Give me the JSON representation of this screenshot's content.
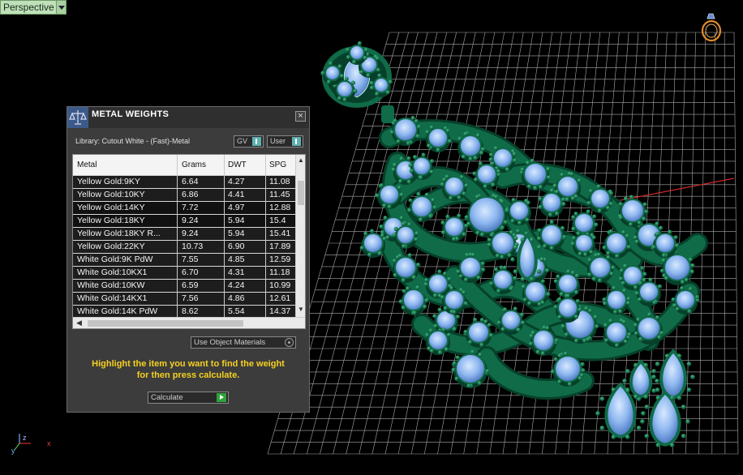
{
  "viewport": {
    "view_label": "Perspective",
    "axis_labels": {
      "y": "y",
      "z": "z",
      "x": "x"
    }
  },
  "panel": {
    "title": "METAL WEIGHTS",
    "library": "Library: Cutout White - (Fast)-Metal",
    "toggle_gv": "GV",
    "toggle_user": "User",
    "columns": [
      "Metal",
      "Grams",
      "DWT",
      "SPG"
    ],
    "rows": [
      [
        "Yellow Gold:9KY",
        "6.64",
        "4.27",
        "11.08"
      ],
      [
        "Yellow Gold:10KY",
        "6.86",
        "4.41",
        "11.45"
      ],
      [
        "Yellow Gold:14KY",
        "7.72",
        "4.97",
        "12.88"
      ],
      [
        "Yellow Gold:18KY",
        "9.24",
        "5.94",
        "15.4"
      ],
      [
        "Yellow Gold:18KY R...",
        "9.24",
        "5.94",
        "15.41"
      ],
      [
        "Yellow Gold:22KY",
        "10.73",
        "6.90",
        "17.89"
      ],
      [
        "White Gold:9K PdW",
        "7.55",
        "4.85",
        "12.59"
      ],
      [
        "White Gold:10KX1",
        "6.70",
        "4.31",
        "11.18"
      ],
      [
        "White Gold:10KW",
        "6.59",
        "4.24",
        "10.99"
      ],
      [
        "White Gold:14KX1",
        "7.56",
        "4.86",
        "12.61"
      ],
      [
        "White Gold:14K PdW",
        "8.62",
        "5.54",
        "14.37"
      ]
    ],
    "use_object_materials": "Use Object Materials",
    "hint_line1": "Highlight the item you want to find the weight",
    "hint_line2": "for then press calculate.",
    "calculate": "Calculate"
  },
  "colors": {
    "highlight": "#f07a18",
    "hint": "#f5d020",
    "metal": "#0f6b48",
    "gem": "#8fb8f0",
    "grid": "#a8a8a8"
  }
}
